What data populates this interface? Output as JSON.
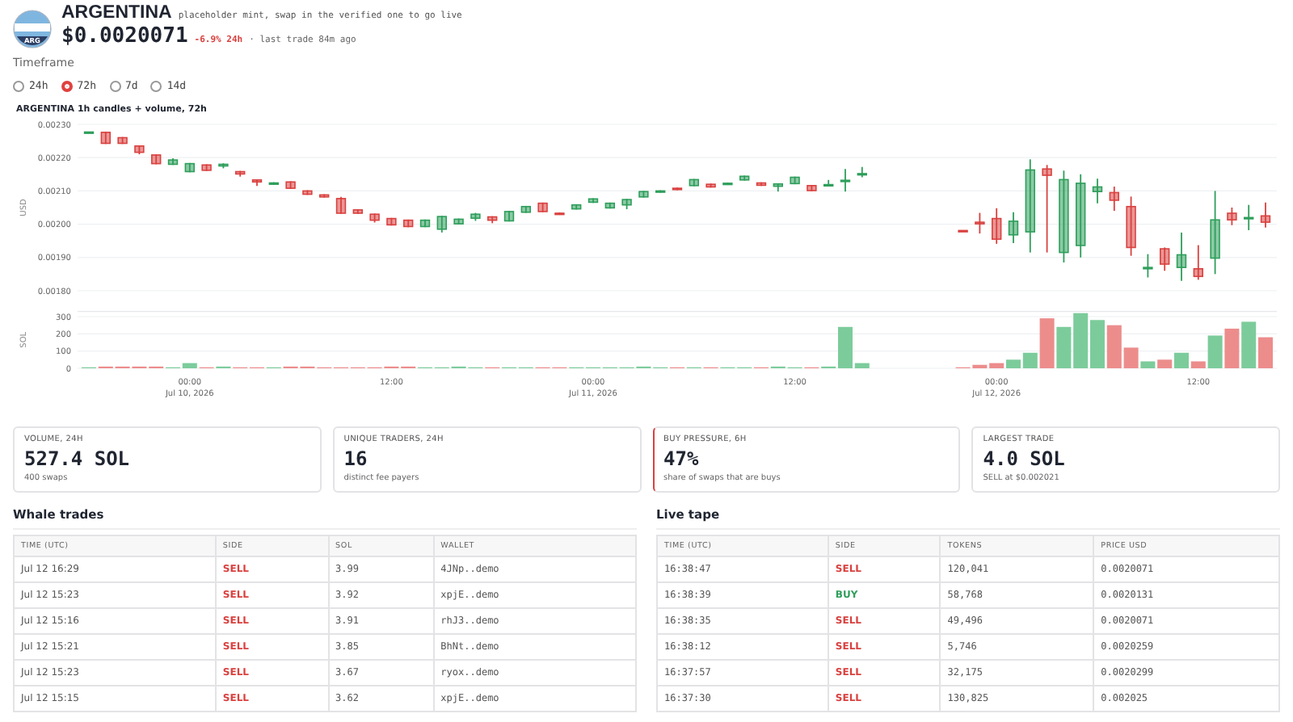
{
  "token": {
    "logo_text": "ARG",
    "name": "ARGENTINA",
    "note": "placeholder mint, swap in the verified one to go live",
    "price": "$0.0020071",
    "change": "-6.9% 24h",
    "last_trade": "· last trade 84m ago"
  },
  "timeframe": {
    "label": "Timeframe",
    "options": [
      {
        "label": "24h",
        "selected": false
      },
      {
        "label": "72h",
        "selected": true
      },
      {
        "label": "7d",
        "selected": false
      },
      {
        "label": "14d",
        "selected": false
      }
    ]
  },
  "chart": {
    "title": "ARGENTINA 1h candles + volume, 72h",
    "price_panel": {
      "chart_data": {
        "type": "candlestick",
        "ylabel": "USD",
        "grid": true,
        "ylim": [
          0.0018,
          0.0023
        ],
        "yticks": [
          {
            "value": 0.0023,
            "label": "0.00230"
          },
          {
            "value": 0.0022,
            "label": "0.00220"
          },
          {
            "value": 0.0021,
            "label": "0.00210"
          },
          {
            "value": 0.002,
            "label": "0.00200"
          },
          {
            "value": 0.0019,
            "label": "0.00190"
          },
          {
            "value": 0.0018,
            "label": "0.00180"
          }
        ],
        "categories": [
          null,
          null,
          null,
          null,
          null,
          null,
          null,
          null,
          null,
          null,
          null,
          null,
          null,
          null,
          null,
          null,
          null,
          null,
          null,
          null,
          null,
          null,
          null,
          null,
          null,
          null,
          null,
          null,
          null,
          null,
          null,
          null,
          null,
          null,
          null,
          null,
          null,
          null,
          null,
          null,
          null,
          null,
          null,
          null,
          null,
          null,
          null,
          null,
          null,
          null,
          null,
          null,
          null,
          null,
          null,
          null,
          null,
          null,
          null,
          null,
          null,
          null,
          null,
          null,
          null,
          null,
          null,
          null,
          null,
          null,
          null
        ],
        "ohlc": [
          [
            0.002275,
            0.002278,
            0.002274,
            0.002277
          ],
          [
            0.002276,
            0.002278,
            0.002241,
            0.002243
          ],
          [
            0.00226,
            0.002262,
            0.002241,
            0.002243
          ],
          [
            0.002235,
            0.002237,
            0.00221,
            0.002216
          ],
          [
            0.002208,
            0.00221,
            0.00218,
            0.002182
          ],
          [
            0.00218,
            0.002198,
            0.002178,
            0.002193
          ],
          [
            0.002158,
            0.002184,
            0.002156,
            0.002182
          ],
          [
            0.002178,
            0.00218,
            0.00216,
            0.002162
          ],
          [
            0.002175,
            0.002183,
            0.002168,
            0.00218
          ],
          [
            0.002158,
            0.00216,
            0.002143,
            0.002151
          ],
          [
            0.002133,
            0.002135,
            0.002115,
            0.002127
          ],
          [
            0.00212,
            0.002126,
            0.002118,
            0.002124
          ],
          [
            0.002127,
            0.002129,
            0.002106,
            0.002108
          ],
          [
            0.0021,
            0.002102,
            0.002088,
            0.00209
          ],
          [
            0.002088,
            0.00209,
            0.00208,
            0.002082
          ],
          [
            0.002077,
            0.002082,
            0.002031,
            0.002033
          ],
          [
            0.002043,
            0.002045,
            0.002031,
            0.002033
          ],
          [
            0.00203,
            0.002032,
            0.002005,
            0.002012
          ],
          [
            0.002017,
            0.002019,
            0.001996,
            0.001998
          ],
          [
            0.002012,
            0.002014,
            0.001991,
            0.001993
          ],
          [
            0.001993,
            0.002014,
            0.001991,
            0.002012
          ],
          [
            0.001985,
            0.002025,
            0.001975,
            0.002023
          ],
          [
            0.002001,
            0.002017,
            0.001999,
            0.002015
          ],
          [
            0.002018,
            0.002034,
            0.00201,
            0.00203
          ],
          [
            0.002022,
            0.002024,
            0.002003,
            0.002012
          ],
          [
            0.00201,
            0.00204,
            0.002008,
            0.002038
          ],
          [
            0.002036,
            0.002055,
            0.002034,
            0.002053
          ],
          [
            0.002063,
            0.002065,
            0.002036,
            0.002038
          ],
          [
            0.002033,
            0.002035,
            0.002028,
            0.00203
          ],
          [
            0.002046,
            0.00206,
            0.002044,
            0.002058
          ],
          [
            0.002066,
            0.002078,
            0.002064,
            0.002076
          ],
          [
            0.002049,
            0.002065,
            0.002047,
            0.002063
          ],
          [
            0.002058,
            0.002076,
            0.002045,
            0.002074
          ],
          [
            0.002082,
            0.0021,
            0.00208,
            0.002098
          ],
          [
            0.002097,
            0.002102,
            0.002095,
            0.0021
          ],
          [
            0.002108,
            0.00211,
            0.002102,
            0.002104
          ],
          [
            0.002116,
            0.002136,
            0.002114,
            0.002134
          ],
          [
            0.00212,
            0.002122,
            0.00211,
            0.002112
          ],
          [
            0.002121,
            0.002125,
            0.002119,
            0.002123
          ],
          [
            0.002133,
            0.002146,
            0.002131,
            0.002144
          ],
          [
            0.002124,
            0.002126,
            0.002115,
            0.002117
          ],
          [
            0.002114,
            0.002123,
            0.002098,
            0.002121
          ],
          [
            0.002122,
            0.002143,
            0.00212,
            0.002141
          ],
          [
            0.002116,
            0.002118,
            0.002099,
            0.002101
          ],
          [
            0.002118,
            0.002133,
            0.002116,
            0.002119
          ],
          [
            0.002131,
            0.002166,
            0.002098,
            0.002132
          ],
          [
            0.00215,
            0.002172,
            0.002141,
            0.002152
          ],
          null,
          null,
          null,
          null,
          null,
          [
            0.001981,
            0.001982,
            0.001979,
            0.00198
          ],
          [
            0.002006,
            0.002034,
            0.001972,
            0.002001
          ],
          [
            0.002017,
            0.002048,
            0.001941,
            0.001955
          ],
          [
            0.001968,
            0.002036,
            0.001943,
            0.002009
          ],
          [
            0.001977,
            0.002195,
            0.001915,
            0.002163
          ],
          [
            0.002166,
            0.002178,
            0.001915,
            0.002147
          ],
          [
            0.001915,
            0.002161,
            0.001885,
            0.002134
          ],
          [
            0.001936,
            0.00215,
            0.0019,
            0.002123
          ],
          [
            0.002098,
            0.002137,
            0.002063,
            0.002112
          ],
          [
            0.002095,
            0.002113,
            0.00204,
            0.002072
          ],
          [
            0.002053,
            0.002083,
            0.001905,
            0.00193
          ],
          [
            0.001866,
            0.00191,
            0.00184,
            0.00187
          ],
          [
            0.001926,
            0.00193,
            0.00186,
            0.00188
          ],
          [
            0.00187,
            0.001975,
            0.00183,
            0.001908
          ],
          [
            0.001866,
            0.001937,
            0.001833,
            0.001843
          ],
          [
            0.001898,
            0.0021,
            0.00185,
            0.002013
          ],
          [
            0.002033,
            0.00205,
            0.001997,
            0.002013
          ],
          [
            0.002017,
            0.002058,
            0.001982,
            0.00202
          ],
          [
            0.002025,
            0.002065,
            0.00199,
            0.002006
          ]
        ]
      }
    },
    "volume_panel": {
      "chart_data": {
        "type": "bar",
        "ylabel": "SOL",
        "grid": true,
        "ylim": [
          0,
          330
        ],
        "yticks": [
          0,
          100,
          200,
          300
        ],
        "categories": [
          null,
          null,
          null,
          null,
          null,
          null,
          "00:00\nJul 10, 2026",
          null,
          null,
          null,
          null,
          null,
          null,
          null,
          null,
          null,
          null,
          null,
          "12:00",
          null,
          null,
          null,
          null,
          null,
          null,
          null,
          null,
          null,
          null,
          null,
          "00:00\nJul 11, 2026",
          null,
          null,
          null,
          null,
          null,
          null,
          null,
          null,
          null,
          null,
          null,
          "12:00",
          null,
          null,
          null,
          null,
          null,
          null,
          null,
          null,
          null,
          null,
          null,
          "00:00\nJul 12, 2026",
          null,
          null,
          null,
          null,
          null,
          null,
          null,
          null,
          null,
          null,
          null,
          "12:00",
          null,
          null,
          null,
          null
        ],
        "values": [
          0,
          10,
          10,
          10,
          10,
          0,
          30,
          0,
          10,
          0,
          0,
          0,
          10,
          10,
          0,
          0,
          0,
          0,
          10,
          10,
          0,
          0,
          10,
          0,
          0,
          0,
          0,
          0,
          0,
          0,
          0,
          0,
          0,
          10,
          0,
          0,
          0,
          0,
          0,
          0,
          0,
          10,
          0,
          0,
          10,
          240,
          30,
          null,
          null,
          null,
          null,
          null,
          0,
          20,
          30,
          50,
          90,
          290,
          240,
          320,
          280,
          250,
          120,
          40,
          50,
          90,
          40,
          190,
          230,
          270,
          180
        ]
      }
    }
  },
  "stats": [
    {
      "label": "VOLUME, 24H",
      "value": "527.4 SOL",
      "note": "400 swaps",
      "accent": false
    },
    {
      "label": "UNIQUE TRADERS, 24H",
      "value": "16",
      "note": "distinct fee payers",
      "accent": false
    },
    {
      "label": "BUY PRESSURE, 6H",
      "value": "47%",
      "note": "share of swaps that are buys",
      "accent": true
    },
    {
      "label": "LARGEST TRADE",
      "value": "4.0 SOL",
      "note": "SELL at $0.002021",
      "accent": false
    }
  ],
  "whale_trades": {
    "title": "Whale trades",
    "columns": [
      "TIME (UTC)",
      "SIDE",
      "SOL",
      "WALLET"
    ],
    "rows": [
      {
        "cells": [
          "Jul 12 16:29",
          "SELL",
          "3.99",
          "4JNp..demo"
        ],
        "kind": "sell"
      },
      {
        "cells": [
          "Jul 12 15:23",
          "SELL",
          "3.92",
          "xpjE..demo"
        ],
        "kind": "sell"
      },
      {
        "cells": [
          "Jul 12 15:16",
          "SELL",
          "3.91",
          "rhJ3..demo"
        ],
        "kind": "sell"
      },
      {
        "cells": [
          "Jul 12 15:21",
          "SELL",
          "3.85",
          "BhNt..demo"
        ],
        "kind": "sell"
      },
      {
        "cells": [
          "Jul 12 15:23",
          "SELL",
          "3.67",
          "ryox..demo"
        ],
        "kind": "sell"
      },
      {
        "cells": [
          "Jul 12 15:15",
          "SELL",
          "3.62",
          "xpjE..demo"
        ],
        "kind": "sell"
      }
    ]
  },
  "live_tape": {
    "title": "Live tape",
    "columns": [
      "TIME (UTC)",
      "SIDE",
      "TOKENS",
      "PRICE USD"
    ],
    "rows": [
      {
        "cells": [
          "16:38:47",
          "SELL",
          "120,041",
          "0.0020071"
        ],
        "kind": "sell"
      },
      {
        "cells": [
          "16:38:39",
          "BUY",
          "58,768",
          "0.0020131"
        ],
        "kind": "buy"
      },
      {
        "cells": [
          "16:38:35",
          "SELL",
          "49,496",
          "0.0020071"
        ],
        "kind": "sell"
      },
      {
        "cells": [
          "16:38:12",
          "SELL",
          "5,746",
          "0.0020259"
        ],
        "kind": "sell"
      },
      {
        "cells": [
          "16:37:57",
          "SELL",
          "32,175",
          "0.0020299"
        ],
        "kind": "sell"
      },
      {
        "cells": [
          "16:37:30",
          "SELL",
          "130,825",
          "0.002025"
        ],
        "kind": "sell"
      }
    ]
  }
}
